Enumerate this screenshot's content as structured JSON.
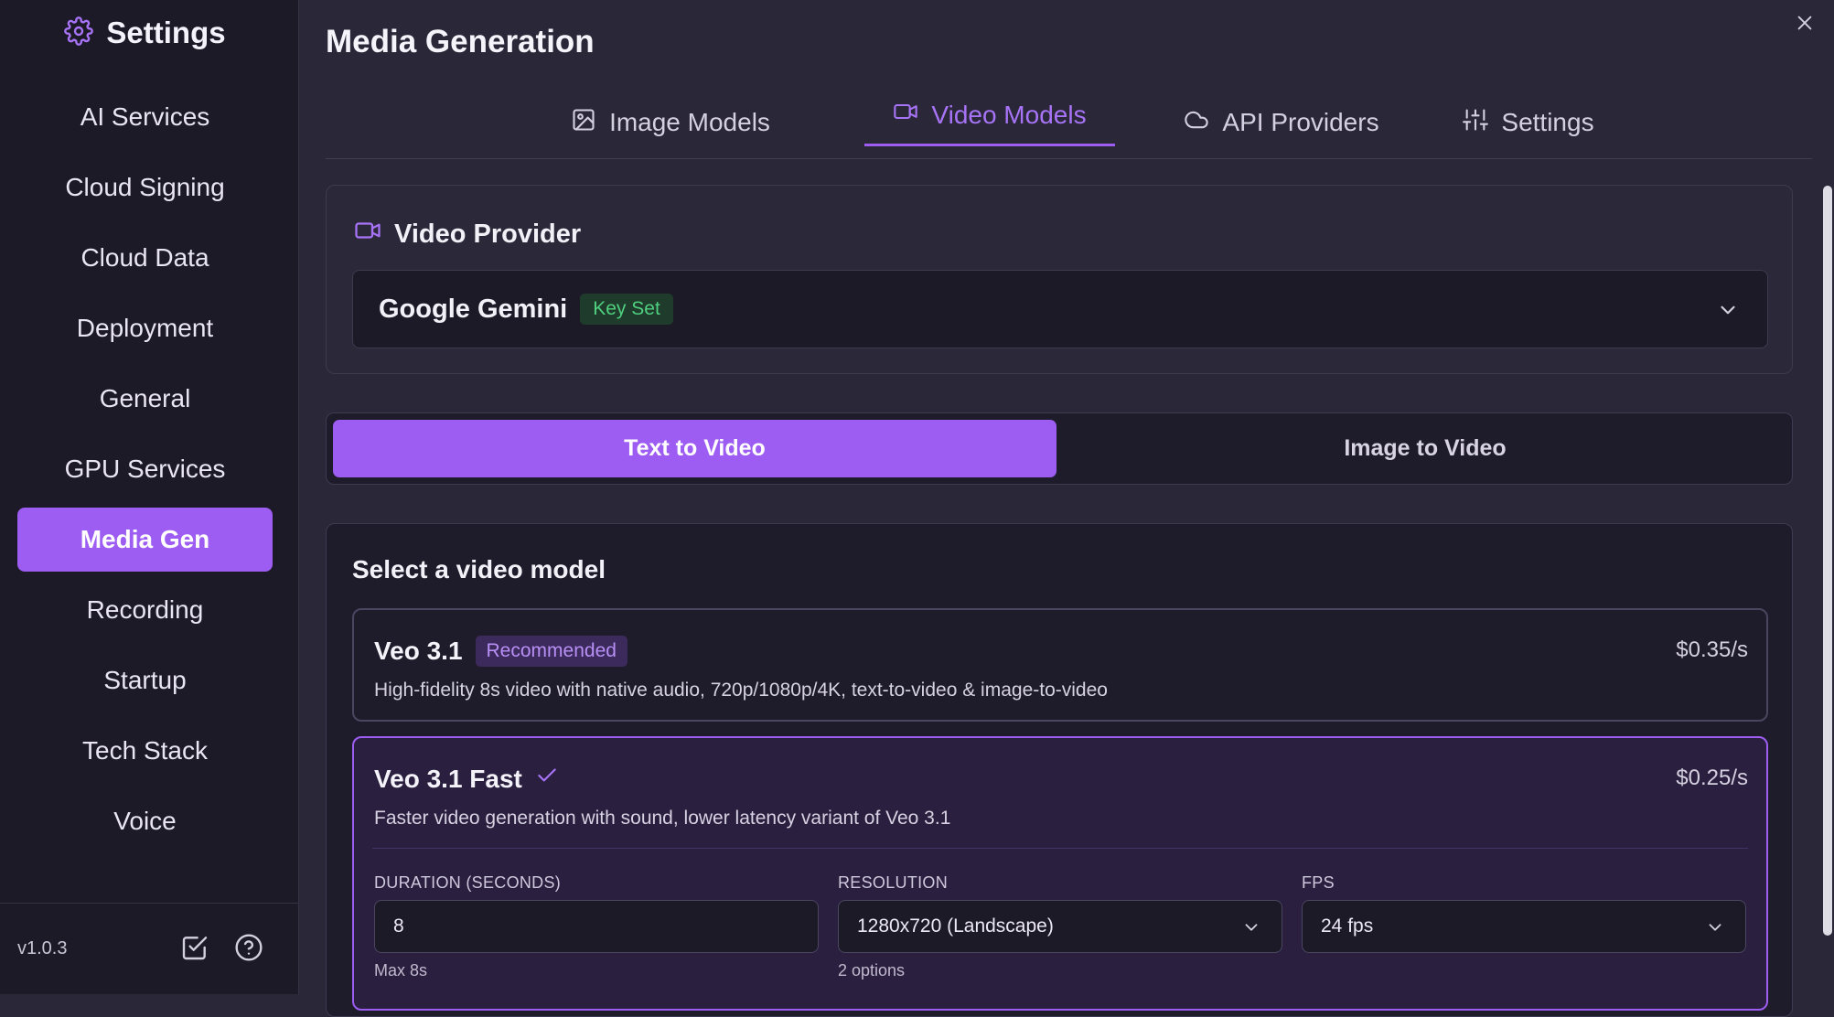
{
  "sidebar": {
    "title": "Settings",
    "items": [
      {
        "label": "AI Services"
      },
      {
        "label": "Cloud Signing"
      },
      {
        "label": "Cloud Data"
      },
      {
        "label": "Deployment"
      },
      {
        "label": "General"
      },
      {
        "label": "GPU Services"
      },
      {
        "label": "Media Gen",
        "active": true
      },
      {
        "label": "Recording"
      },
      {
        "label": "Startup"
      },
      {
        "label": "Tech Stack"
      },
      {
        "label": "Voice"
      }
    ],
    "version": "v1.0.3",
    "footer_icons": [
      "checklist-icon",
      "help-icon"
    ]
  },
  "header": {
    "title": "Media Generation",
    "close_icon": "close-icon"
  },
  "tabs": [
    {
      "label": "Image Models",
      "icon": "image-icon"
    },
    {
      "label": "Video Models",
      "icon": "video-camera-icon",
      "active": true
    },
    {
      "label": "API Providers",
      "icon": "cloud-icon"
    },
    {
      "label": "Settings",
      "icon": "sliders-icon"
    }
  ],
  "provider": {
    "heading": "Video Provider",
    "selected": "Google Gemini",
    "badge": "Key Set"
  },
  "mode": {
    "options": [
      "Text to Video",
      "Image to Video"
    ],
    "selected": "Text to Video"
  },
  "models": {
    "title": "Select a video model",
    "items": [
      {
        "name": "Veo 3.1",
        "badge": "Recommended",
        "price": "$0.35/s",
        "description": "High-fidelity 8s video with native audio, 720p/1080p/4K, text-to-video & image-to-video"
      },
      {
        "name": "Veo 3.1 Fast",
        "price": "$0.25/s",
        "selected": true,
        "description": "Faster video generation with sound, lower latency variant of Veo 3.1",
        "settings": {
          "duration": {
            "label": "DURATION (SECONDS)",
            "value": "8",
            "hint": "Max 8s"
          },
          "resolution": {
            "label": "RESOLUTION",
            "value": "1280x720 (Landscape)",
            "hint": "2 options"
          },
          "fps": {
            "label": "FPS",
            "value": "24 fps"
          }
        }
      }
    ]
  },
  "colors": {
    "accent": "#9d5cf2",
    "background": "#2a2738",
    "sidebar": "#1c1a27",
    "success": "#4fcf7f"
  }
}
